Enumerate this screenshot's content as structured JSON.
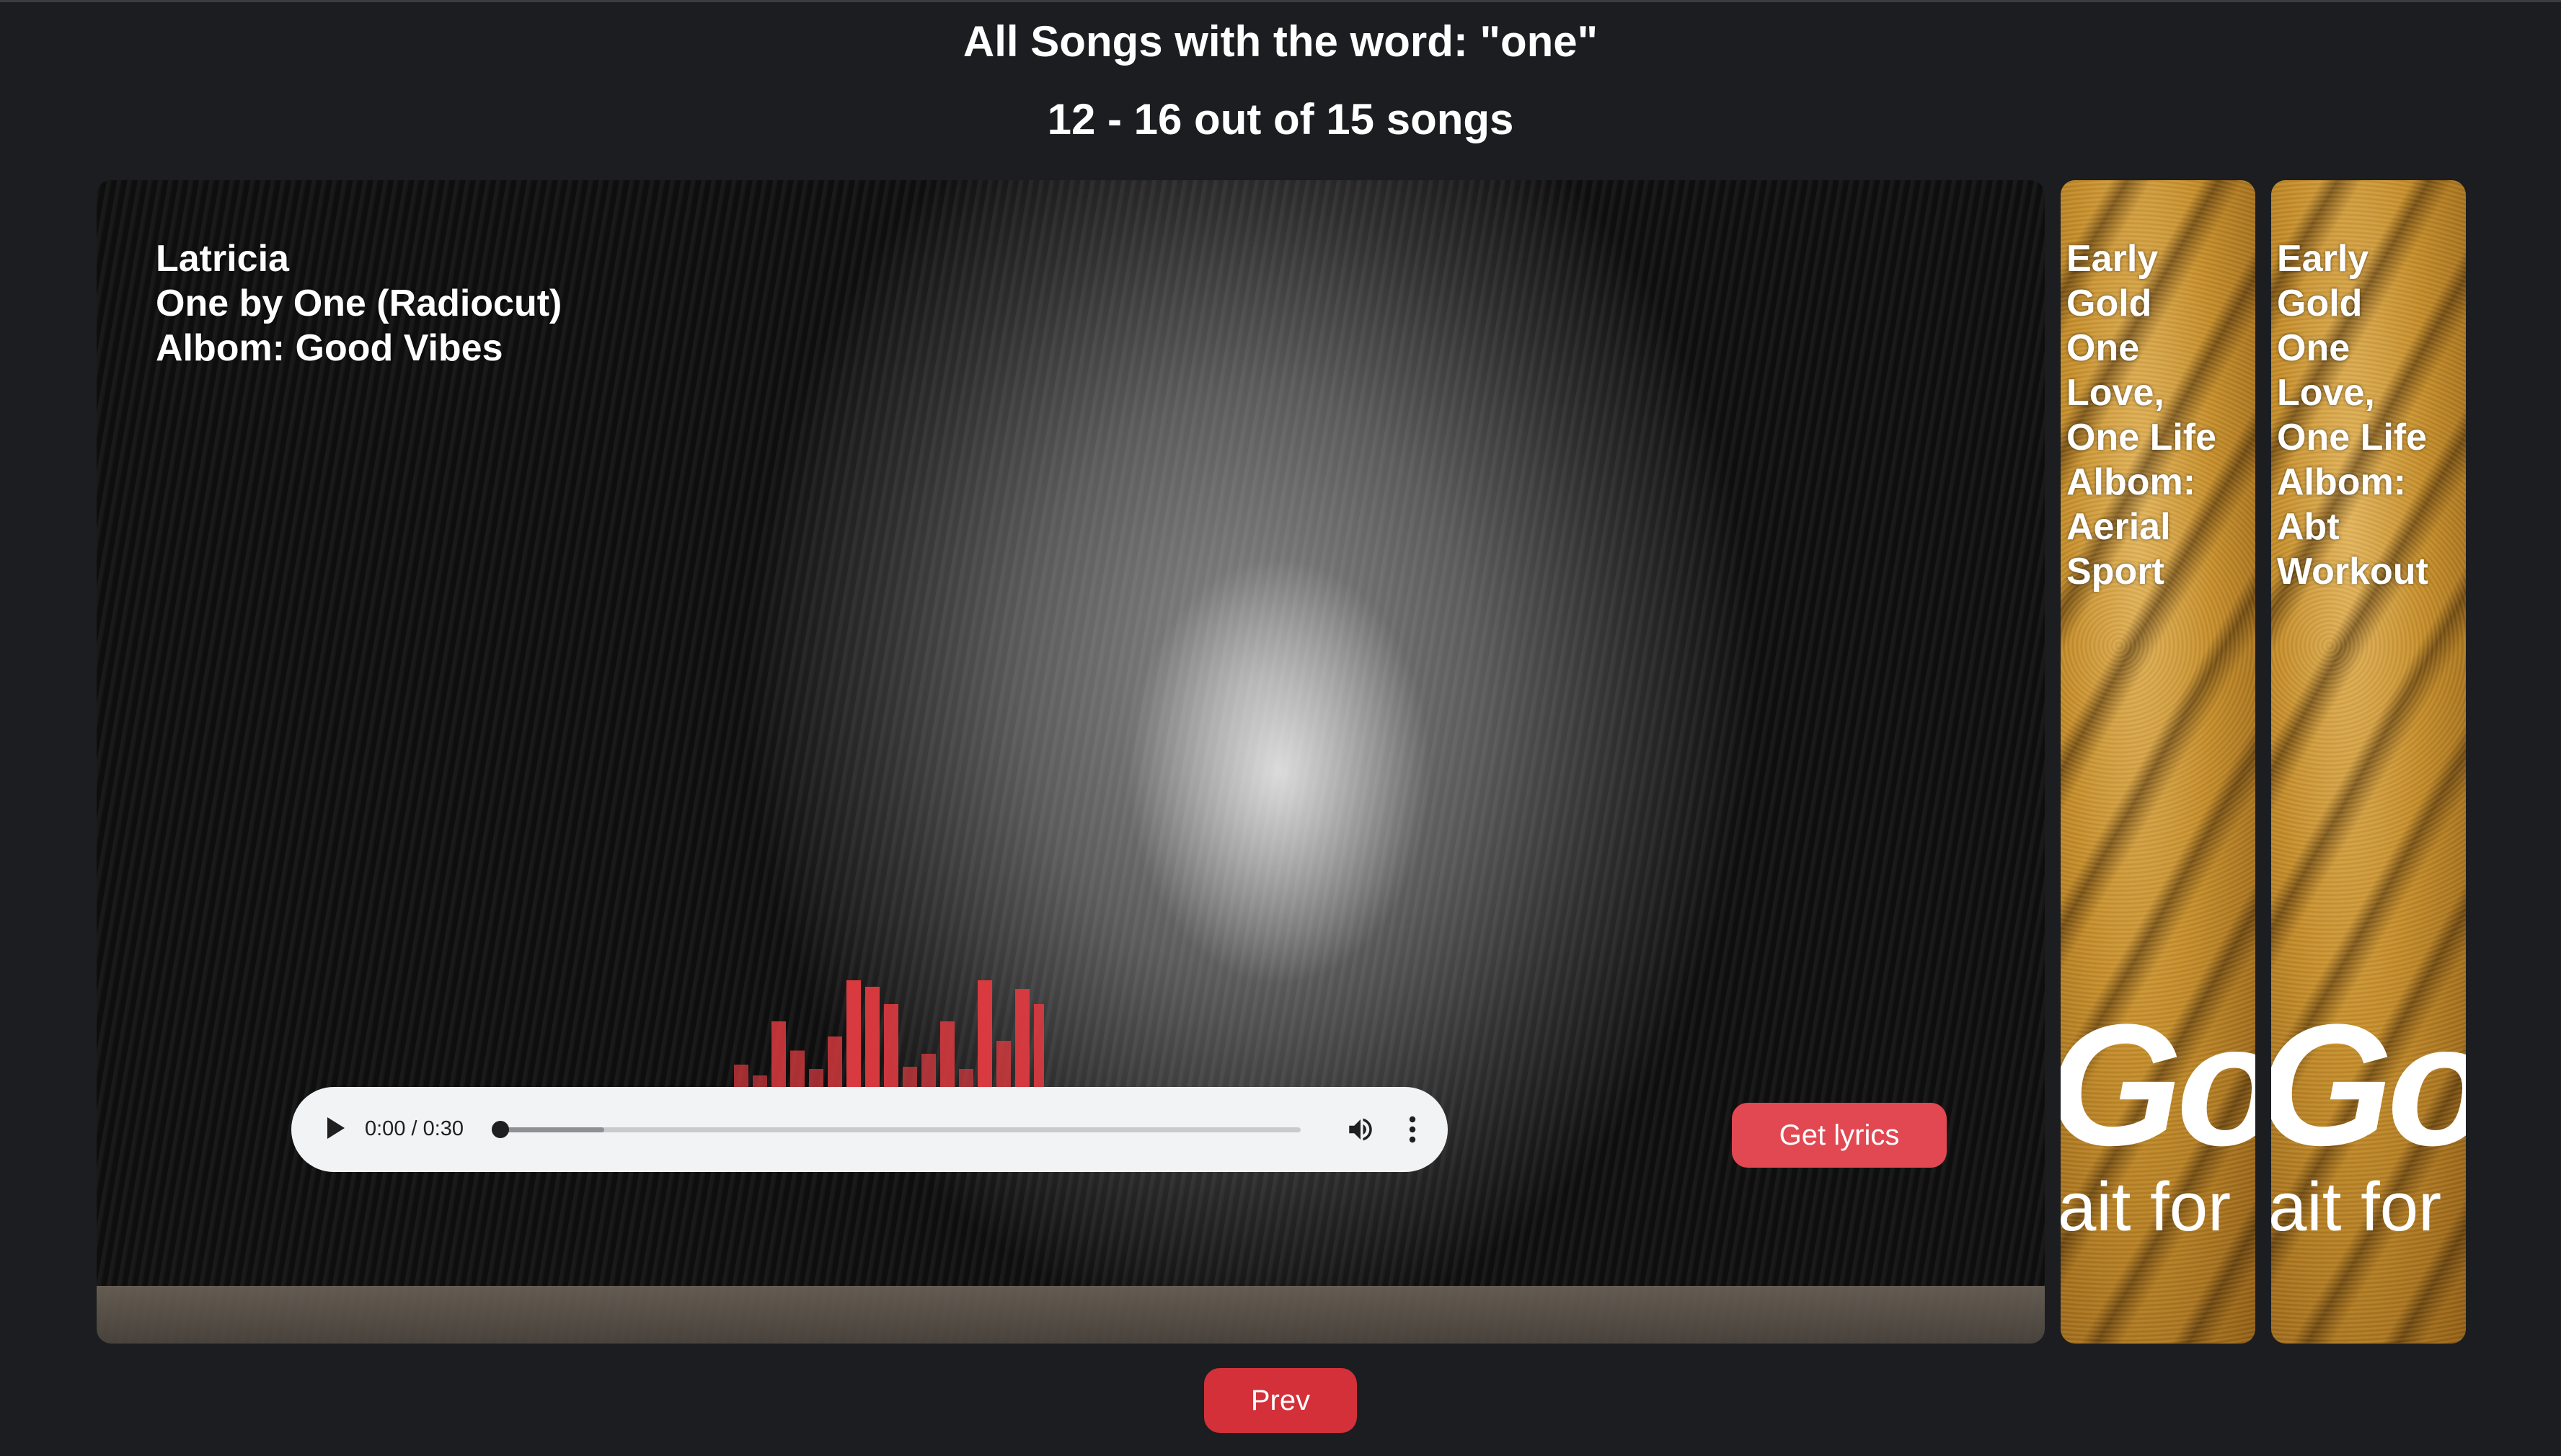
{
  "header": {
    "title": "All Songs with the word: \"one\"",
    "range": "12 - 16 out of 15 songs"
  },
  "featured": {
    "artist": "Latricia",
    "song": "One by One (Radiocut)",
    "album": "Albom: Good Vibes",
    "player": {
      "time": "0:00 / 0:30",
      "progress": 0,
      "buffered": 0.13
    },
    "lyrics_button": "Get lyrics",
    "visualizer_levels": [
      0.22,
      0.12,
      0.62,
      0.35,
      0.18,
      0.48,
      1.0,
      0.94,
      0.78,
      0.2,
      0.32,
      0.62,
      0.18,
      1.0,
      0.44,
      0.92,
      0.78
    ],
    "visualizer_color": "#d93a3f"
  },
  "side_cards": [
    {
      "artist": "Early Gold",
      "song": "One Love, One Life",
      "album": "Albom: Aerial Sport",
      "cover_text_big": "Gol",
      "cover_text_small": "ait for"
    },
    {
      "artist": "Early Gold",
      "song": "One Love, One Life",
      "album": "Albom: Abt Workout",
      "cover_text_big": "Gol",
      "cover_text_small": "ait for"
    }
  ],
  "pager": {
    "prev_label": "Prev"
  },
  "colors": {
    "background": "#1b1d20",
    "accent_button": "#e14852",
    "prev_button": "#d3303a"
  }
}
